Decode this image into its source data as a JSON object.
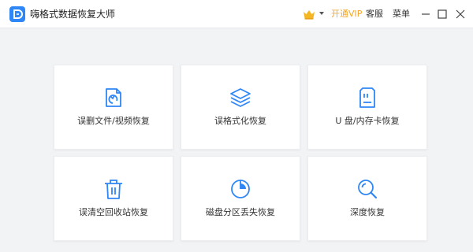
{
  "app": {
    "title": "嗨格式数据恢复大师"
  },
  "header": {
    "vip_label": "开通VIP",
    "service_label": "客服",
    "menu_label": "菜单"
  },
  "colors": {
    "accent": "#2f86f6",
    "vip": "#f5a623",
    "background": "#f2f3f5"
  },
  "cards": [
    {
      "label": "误删文件/视频恢复",
      "icon": "file-restore-icon"
    },
    {
      "label": "误格式化恢复",
      "icon": "layers-icon"
    },
    {
      "label": "U 盘/内存卡恢复",
      "icon": "sd-card-icon"
    },
    {
      "label": "误清空回收站恢复",
      "icon": "trash-icon"
    },
    {
      "label": "磁盘分区丢失恢复",
      "icon": "pie-chart-icon"
    },
    {
      "label": "深度恢复",
      "icon": "magnifier-icon"
    }
  ]
}
